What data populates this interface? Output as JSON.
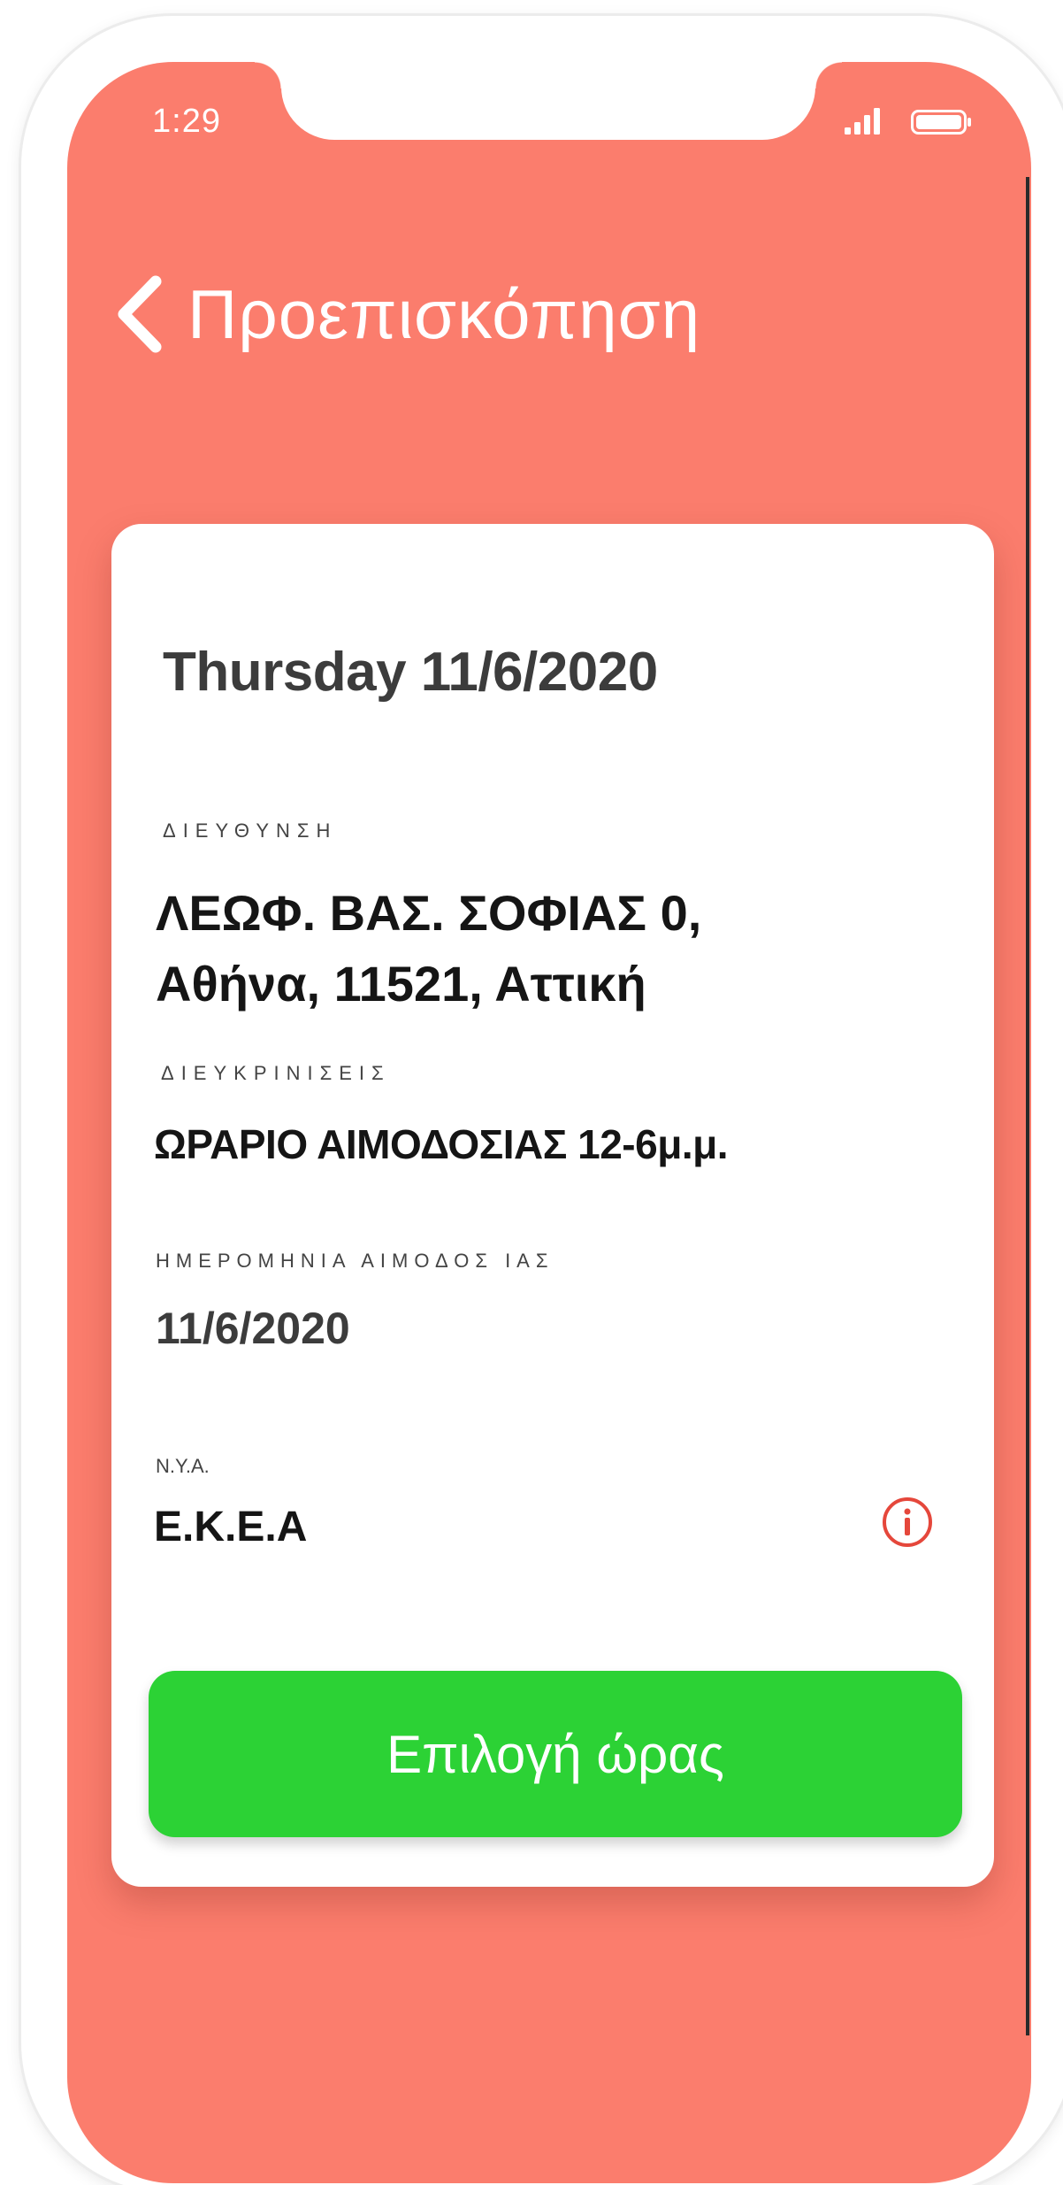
{
  "status_bar": {
    "time": "1:29",
    "signal_icon": "signal-bars-icon",
    "battery_icon": "battery-icon"
  },
  "header": {
    "back_icon": "chevron-left-icon",
    "title": "Προεπισκόπηση"
  },
  "details": {
    "date_heading": "Thursday 11/6/2020",
    "address_label": "ΔΙΕΥΘΥΝΣΗ",
    "address_line1": "ΛΕΩΦ. ΒΑΣ. ΣΟΦΙΑΣ  0,",
    "address_line2": "Αθήνα, 11521, Αττική",
    "notes_label": "ΔΙΕΥΚΡΙΝΙΣΕΙΣ",
    "notes_value": "ΩΡΑΡΙΟ ΑΙΜΟΔΟΣΙΑΣ 12-6μ.μ.",
    "donation_date_label": "ΗΜΕΡΟΜΗΝΙΑ ΑΙΜΟΔΟΣ ΙΑΣ",
    "donation_date_value": "11/6/2020",
    "nya_label": "N.Y.A.",
    "nya_value": "E.K.E.A",
    "info_icon": "info-icon"
  },
  "actions": {
    "select_time_label": "Επιλογή ώρας"
  },
  "colors": {
    "background": "#fb7d6d",
    "card": "#ffffff",
    "primary_button": "#2cd235",
    "info_icon": "#e5473b"
  }
}
